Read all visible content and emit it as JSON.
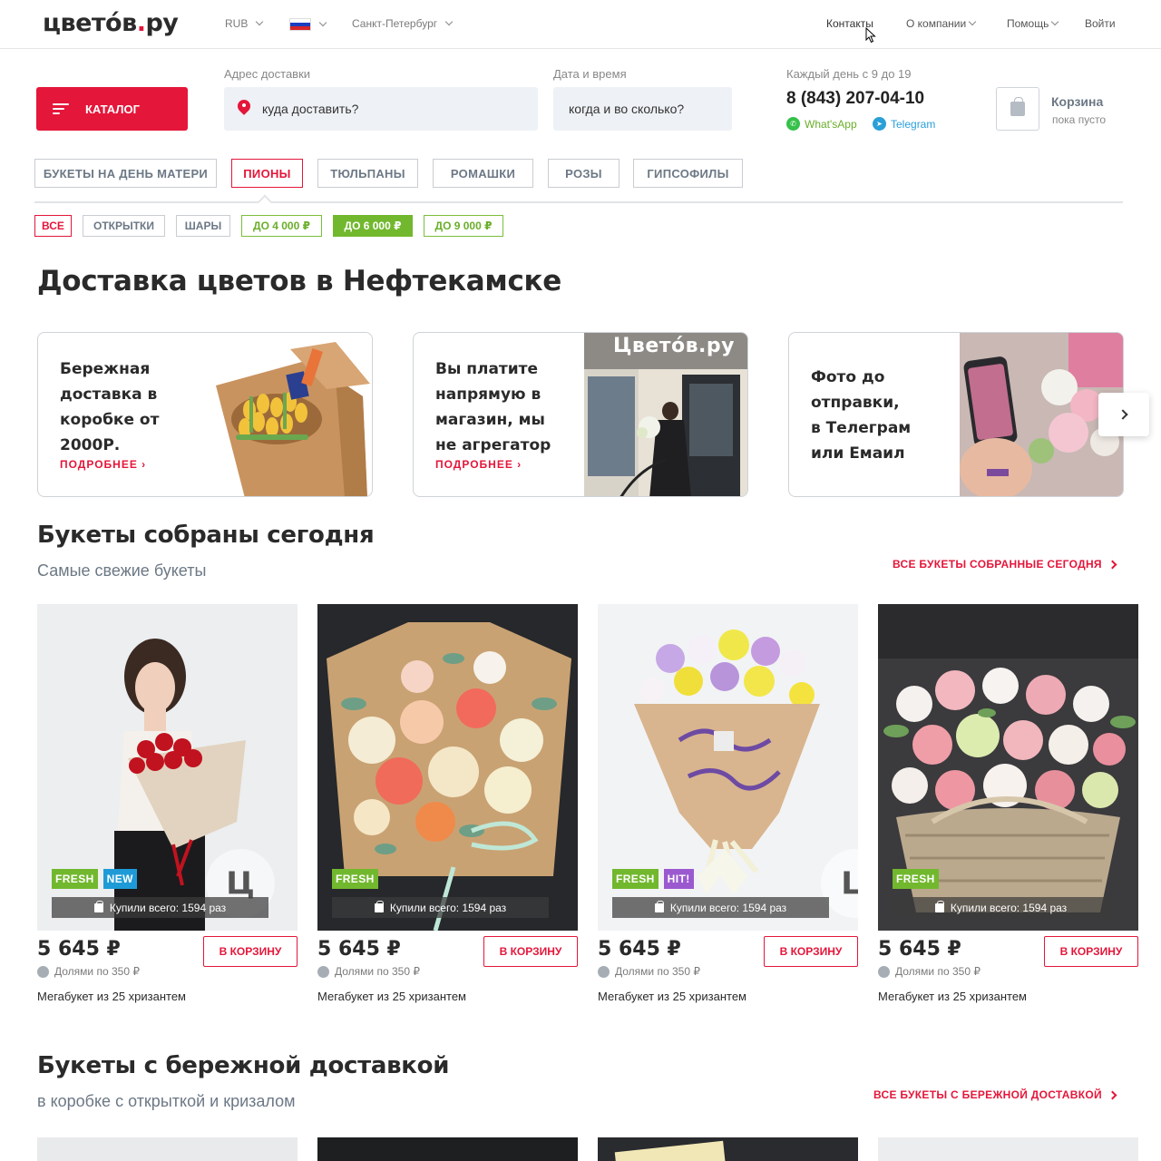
{
  "header": {
    "logo_main": "цвето́в",
    "logo_dot": ".",
    "logo_tail": "ру",
    "currency": "RUB",
    "city": "Санкт-Петербург",
    "nav": [
      "Контакты",
      "О компании",
      "Помощь",
      "Войти"
    ]
  },
  "search": {
    "catalog_label": "КАТАЛОГ",
    "address_label": "Адрес доставки",
    "address_placeholder": "куда доставить?",
    "datetime_label": "Дата и время",
    "datetime_placeholder": "когда и во сколько?",
    "hours": "Каждый день с 9 до 19",
    "phone": "8 (843) 207-04-10",
    "whatsapp": "What'sApp",
    "telegram": "Telegram",
    "cart_title": "Корзина",
    "cart_sub": "пока пусто"
  },
  "tabs": [
    "БУКЕТЫ НА ДЕНЬ МАТЕРИ",
    "ПИОНЫ",
    "ТЮЛЬПАНЫ",
    "РОМАШКИ",
    "РОЗЫ",
    "ГИПСОФИЛЫ"
  ],
  "filters": [
    "ВСЕ",
    "ОТКРЫТКИ",
    "ШАРЫ",
    "ДО 4 000 ₽",
    "ДО 6 000 ₽",
    "ДО 9 000 ₽"
  ],
  "page_title": "Доставка цветов в Нефтекамске",
  "info_cards": [
    {
      "lines": [
        "Бережная",
        "доставка в",
        "коробке от",
        "2000Р."
      ],
      "more": "ПОДРОБНЕЕ ›"
    },
    {
      "lines": [
        "Вы платите",
        "напрямую в",
        "магазин, мы",
        "не агрегатор"
      ],
      "more": "ПОДРОБНЕЕ ›",
      "sign": "Цветóв.ру"
    },
    {
      "lines": [
        "Фото до",
        "отправки,",
        "в Телеграм",
        "или Емаил"
      ]
    }
  ],
  "section1": {
    "title": "Букеты собраны сегодня",
    "subtitle": "Самые свежие букеты",
    "all_link": "ВСЕ БУКЕТЫ СОБРАННЫЕ СЕГОДНЯ"
  },
  "products": [
    {
      "badges": [
        "FRESH",
        "NEW"
      ],
      "bought": "Купили всего: 1594 раз",
      "price": "5 645 ₽",
      "installment": "Долями по 350 ₽",
      "cart": "В КОРЗИНУ",
      "name": "Мегабукет из 25 хризантем",
      "watermark": "Ц"
    },
    {
      "badges": [
        "FRESH"
      ],
      "bought": "Купили всего: 1594 раз",
      "price": "5 645 ₽",
      "installment": "Долями по 350 ₽",
      "cart": "В КОРЗИНУ",
      "name": "Мегабукет из 25 хризантем"
    },
    {
      "badges": [
        "FRESH",
        "HIT!"
      ],
      "bought": "Купили всего: 1594 раз",
      "price": "5 645 ₽",
      "installment": "Долями по 350 ₽",
      "cart": "В КОРЗИНУ",
      "name": "Мегабукет из 25 хризантем",
      "watermark": "Ц"
    },
    {
      "badges": [
        "FRESH"
      ],
      "bought": "Купили всего: 1594 раз",
      "price": "5 645 ₽",
      "installment": "Долями по 350 ₽",
      "cart": "В КОРЗИНУ",
      "name": "Мегабукет из 25 хризантем"
    }
  ],
  "section2": {
    "title": "Букеты с бережной доставкой",
    "subtitle": "в коробке с открыткой и кризалом",
    "all_link": "ВСЕ БУКЕТЫ С БЕРЕЖНОЙ ДОСТАВКОЙ"
  },
  "colors": {
    "accent": "#e4163a",
    "green": "#72b82e",
    "fresh": "#72b82e",
    "new": "#1e9bd7",
    "hit": "#9b59d0",
    "muted": "#6c7885"
  }
}
